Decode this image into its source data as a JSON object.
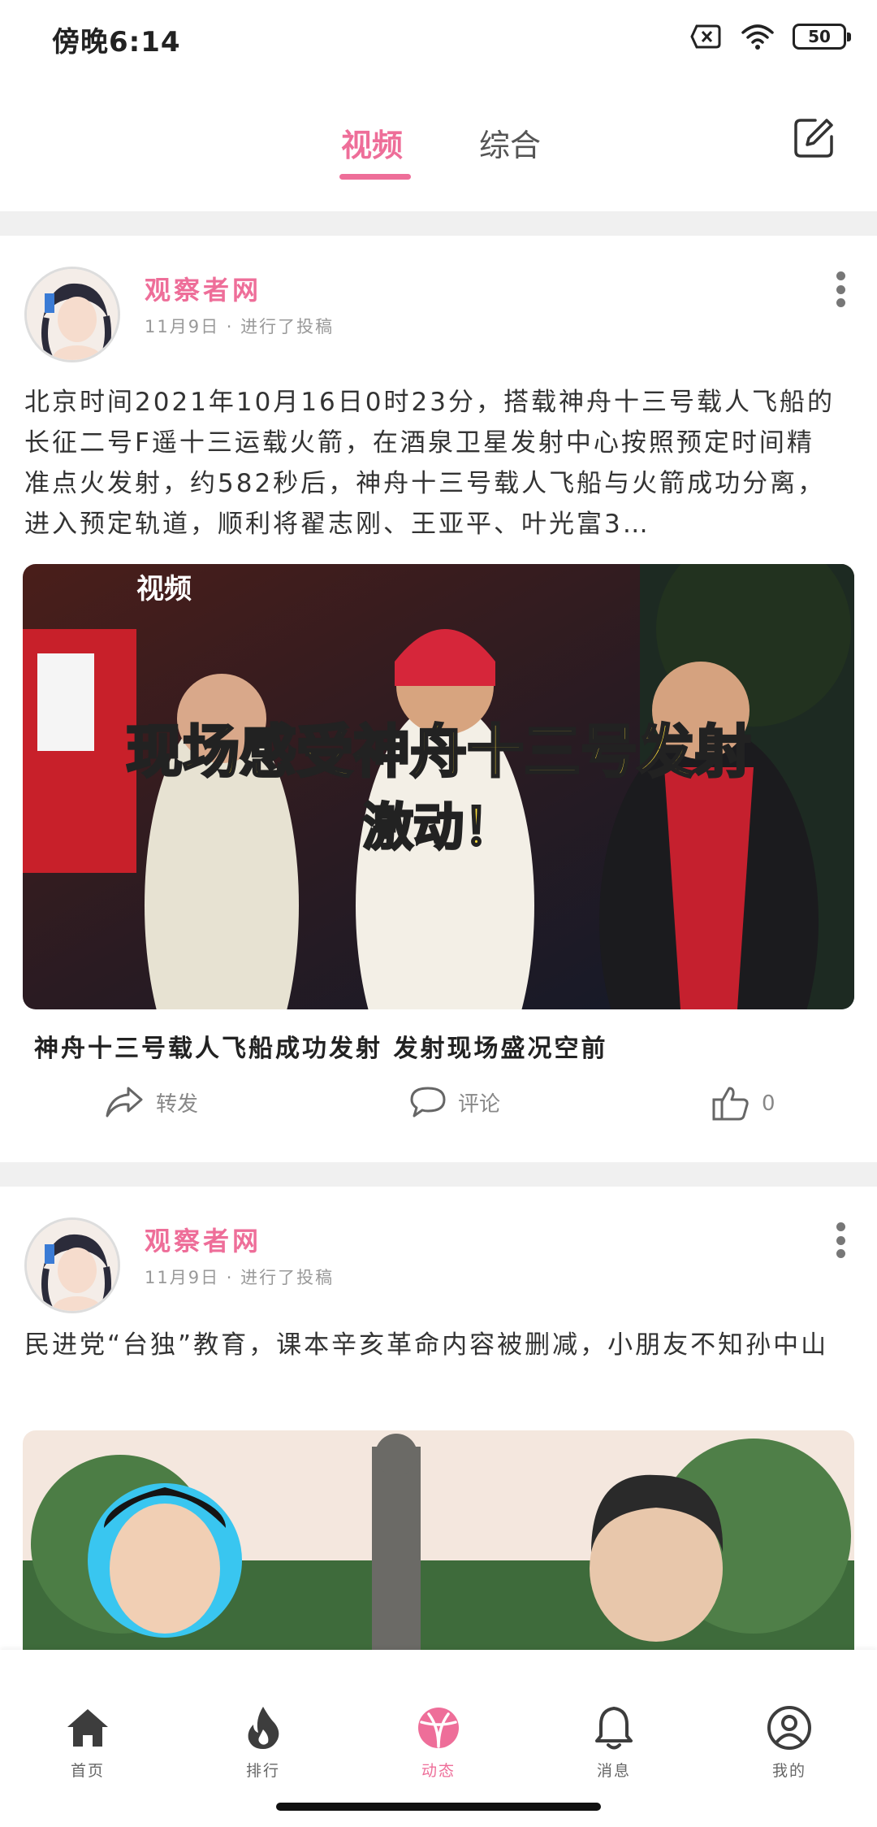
{
  "status_bar": {
    "time": "傍晚6:14",
    "battery": "50",
    "icons": [
      "sim-x-icon",
      "wifi-icon",
      "battery-icon"
    ]
  },
  "top_tabs": [
    {
      "label": "视频",
      "active": true
    },
    {
      "label": "综合",
      "active": false
    }
  ],
  "accent_color": "#ee6e99",
  "posts": [
    {
      "author": "观察者网",
      "meta": "11月9日 · 进行了投稿",
      "text": "北京时间2021年10月16日0时23分，搭载神舟十三号载人飞船的长征二号F遥十三运载火箭，在酒泉卫星发射中心按照预定时间精准点火发射，约582秒后，神舟十三号载人飞船与火箭成功分离，进入预定轨道，顺利将翟志刚、王亚平、叶光富3…",
      "image_title": "现场感受神舟十三号发射",
      "image_subtitle": "激动！",
      "image_tag": "视频",
      "caption": "神舟十三号载人飞船成功发射 发射现场盛况空前",
      "actions": {
        "repost": "转发",
        "comment": "评论",
        "like_count": "0"
      }
    },
    {
      "author": "观察者网",
      "meta": "11月9日 · 进行了投稿",
      "text": "民进党“台独”教育，课本辛亥革命内容被删减，小朋友不知孙中山"
    }
  ],
  "bottom_nav": [
    {
      "label": "首页",
      "icon": "home-icon",
      "active": false
    },
    {
      "label": "排行",
      "icon": "flame-icon",
      "active": false
    },
    {
      "label": "动态",
      "icon": "ball-icon",
      "active": true
    },
    {
      "label": "消息",
      "icon": "bell-icon",
      "active": false
    },
    {
      "label": "我的",
      "icon": "profile-icon",
      "active": false
    }
  ]
}
